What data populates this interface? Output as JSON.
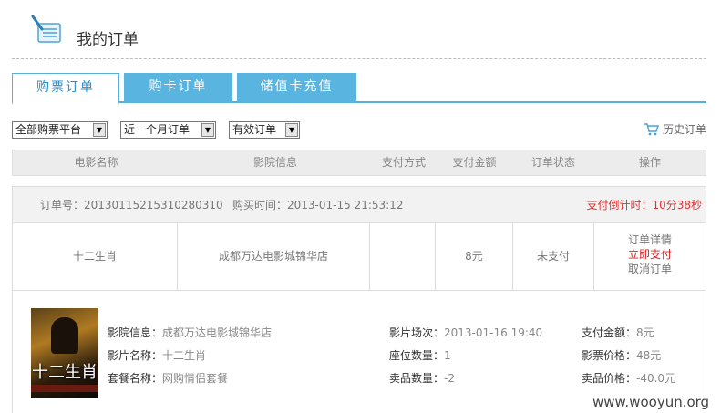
{
  "header": {
    "title": "我的订单"
  },
  "tabs": [
    {
      "label": "购票订单",
      "active": true
    },
    {
      "label": "购卡订单",
      "active": false
    },
    {
      "label": "储值卡充值",
      "active": false
    }
  ],
  "filters": {
    "platform": "全部购票平台",
    "period": "近一个月订单",
    "status": "有效订单",
    "history_label": "历史订单"
  },
  "table_headers": [
    "电影名称",
    "影院信息",
    "支付方式",
    "支付金额",
    "订单状态",
    "操作"
  ],
  "order": {
    "number_label": "订单号：2013011521531028031​0",
    "purchase_time": "购买时间：2013-01-15 21:53:12",
    "countdown": "支付倒计时：10分38秒",
    "movie": "十二生肖",
    "cinema": "成都万达电影城锦华店",
    "payment_method": "",
    "amount": "8元",
    "status": "未支付",
    "actions": [
      "订单详情",
      "立即支付",
      "取消订单"
    ],
    "detail": {
      "cinema_label": "影院信息：",
      "cinema_value": "成都万达电影城锦华店",
      "movie_label": "影片名称：",
      "movie_value": "十二生肖",
      "package_label": "套餐名称：",
      "package_value": "网购情侣套餐",
      "showtime_label": "影片场次：",
      "showtime_value": "2013-01-16 19:40",
      "seat_label": "座位数量：",
      "seat_value": "1",
      "goods_label": "卖品数量：",
      "goods_value": "-2",
      "paid_label": "支付金额：",
      "paid_value": "8元",
      "ticket_label": "影票价格：",
      "ticket_value": "48元",
      "goods_price_label": "卖品价格：",
      "goods_price_value": "-40.0元",
      "poster_text": "十二生肖"
    }
  },
  "watermark": "www.wooyun.org",
  "colors": {
    "tab_blue": "#5ab4e0",
    "accent": "#2a8ccb",
    "alert_red": "#e03333"
  }
}
